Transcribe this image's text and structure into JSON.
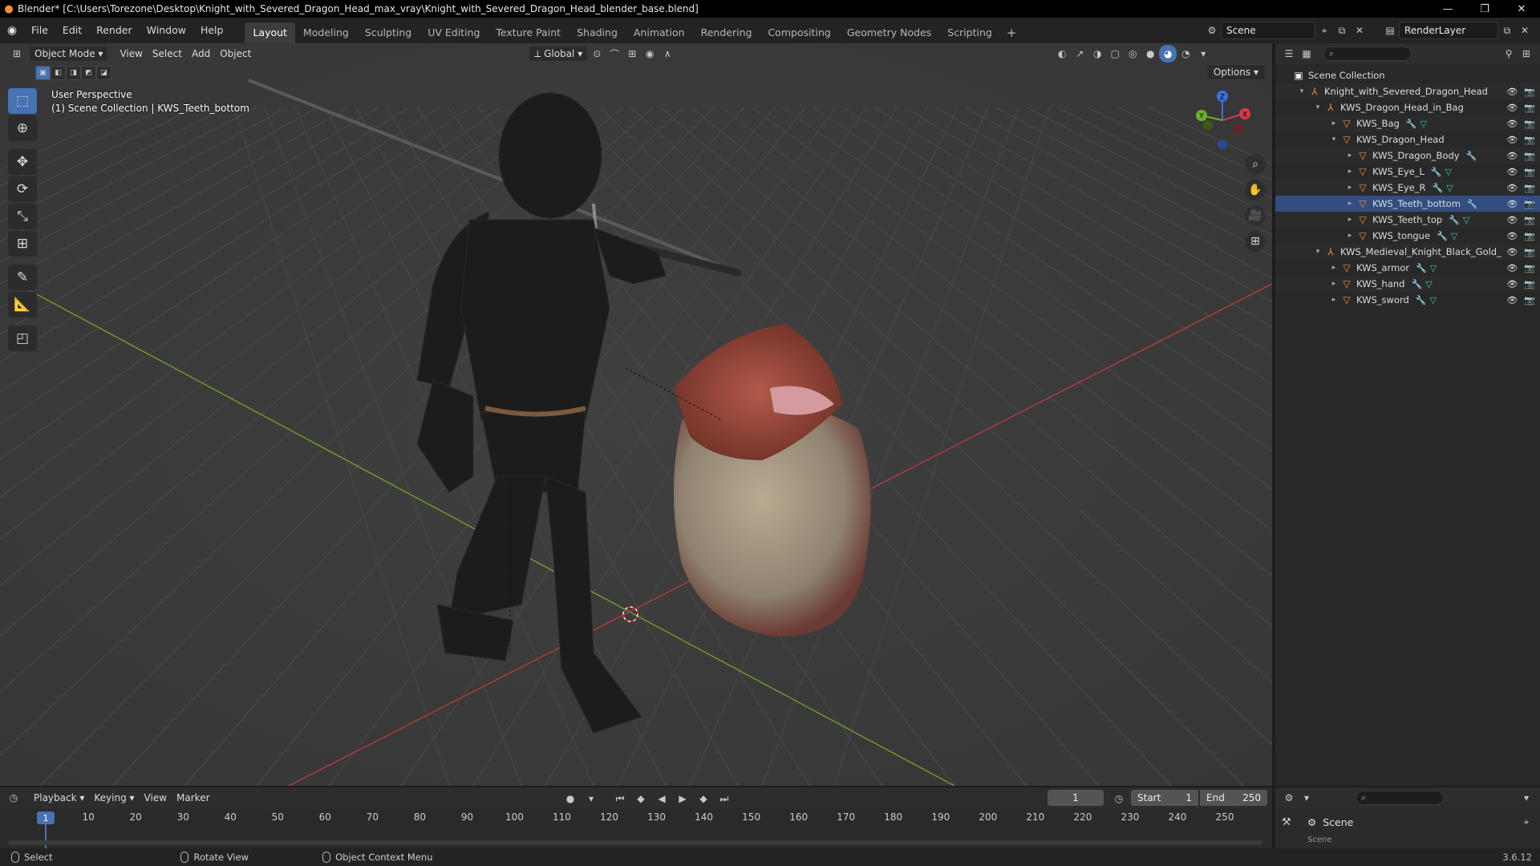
{
  "window": {
    "title": "Blender* [C:\\Users\\Torezone\\Desktop\\Knight_with_Severed_Dragon_Head_max_vray\\Knight_with_Severed_Dragon_Head_blender_base.blend]",
    "minimize": "—",
    "restore": "❐",
    "close": "✕"
  },
  "menu": {
    "items": [
      "File",
      "Edit",
      "Render",
      "Window",
      "Help"
    ],
    "workspaces": [
      "Layout",
      "Modeling",
      "Sculpting",
      "UV Editing",
      "Texture Paint",
      "Shading",
      "Animation",
      "Rendering",
      "Compositing",
      "Geometry Nodes",
      "Scripting"
    ],
    "active_workspace": "Layout",
    "add_workspace": "+",
    "scene": "Scene",
    "view_layer": "RenderLayer"
  },
  "viewport": {
    "mode": "Object Mode",
    "header_menus": [
      "View",
      "Select",
      "Add",
      "Object"
    ],
    "transform_orientation": "Global",
    "options": "Options",
    "info_line1": "User Perspective",
    "info_line2": "(1) Scene Collection | KWS_Teeth_bottom",
    "gizmo": {
      "x": "X",
      "y": "Y",
      "z": "Z"
    }
  },
  "outliner": {
    "search_placeholder": "",
    "rows": [
      {
        "label": "Scene Collection",
        "type": "coll",
        "depth": 0,
        "expand": "",
        "mods": false
      },
      {
        "label": "Knight_with_Severed_Dragon_Head",
        "type": "empty",
        "depth": 1,
        "expand": "▾",
        "mods": false
      },
      {
        "label": "KWS_Dragon_Head_in_Bag",
        "type": "empty",
        "depth": 2,
        "expand": "▾",
        "mods": false
      },
      {
        "label": "KWS_Bag",
        "type": "mesh",
        "depth": 3,
        "expand": "▸",
        "mods": true
      },
      {
        "label": "KWS_Dragon_Head",
        "type": "mesh",
        "depth": 3,
        "expand": "▾",
        "mods": false
      },
      {
        "label": "KWS_Dragon_Body",
        "type": "mesh",
        "depth": 4,
        "expand": "▸",
        "mods": "wrench"
      },
      {
        "label": "KWS_Eye_L",
        "type": "mesh",
        "depth": 4,
        "expand": "▸",
        "mods": true
      },
      {
        "label": "KWS_Eye_R",
        "type": "mesh",
        "depth": 4,
        "expand": "▸",
        "mods": true
      },
      {
        "label": "KWS_Teeth_bottom",
        "type": "mesh",
        "depth": 4,
        "expand": "▸",
        "mods": "wrench",
        "selected": true
      },
      {
        "label": "KWS_Teeth_top",
        "type": "mesh",
        "depth": 4,
        "expand": "▸",
        "mods": true
      },
      {
        "label": "KWS_tongue",
        "type": "mesh",
        "depth": 4,
        "expand": "▸",
        "mods": true
      },
      {
        "label": "KWS_Medieval_Knight_Black_Gold_",
        "type": "empty",
        "depth": 2,
        "expand": "▾",
        "mods": false
      },
      {
        "label": "KWS_armor",
        "type": "mesh",
        "depth": 3,
        "expand": "▸",
        "mods": true
      },
      {
        "label": "KWS_hand",
        "type": "mesh",
        "depth": 3,
        "expand": "▸",
        "mods": true
      },
      {
        "label": "KWS_sword",
        "type": "mesh",
        "depth": 3,
        "expand": "▸",
        "mods": true
      }
    ]
  },
  "timeline": {
    "menus": [
      "Playback",
      "Keying",
      "View",
      "Marker"
    ],
    "current_frame": "1",
    "start_label": "Start",
    "start_value": "1",
    "end_label": "End",
    "end_value": "250",
    "ticks": [
      "10",
      "20",
      "30",
      "40",
      "50",
      "60",
      "70",
      "80",
      "90",
      "100",
      "110",
      "120",
      "130",
      "140",
      "150",
      "160",
      "170",
      "180",
      "190",
      "200",
      "210",
      "220",
      "230",
      "240",
      "250"
    ]
  },
  "properties": {
    "scene_label": "Scene",
    "sub_label": "Scene"
  },
  "status": {
    "select": "Select",
    "rotate": "Rotate View",
    "context": "Object Context Menu",
    "version": "3.6.12"
  },
  "colors": {
    "accent": "#4772b3",
    "selection_row": "#334d80",
    "object_orange": "#e8953a",
    "modifier_blue": "#6a8fd6",
    "mesh_data_green": "#2ed09a"
  }
}
